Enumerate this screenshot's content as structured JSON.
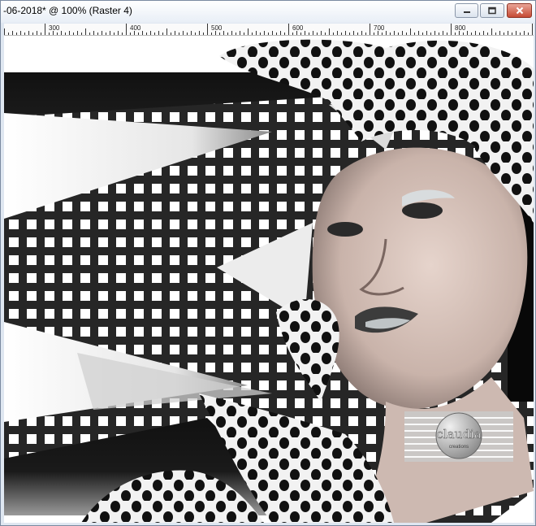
{
  "window": {
    "title": "-06-2018* @ 100% (Raster 4)"
  },
  "ruler": {
    "labels": [
      "300",
      "400",
      "500",
      "600",
      "700",
      "800"
    ]
  },
  "watermark": {
    "name": "claudia",
    "tagline": "creations"
  },
  "icons": {
    "minimize": "minimize-icon",
    "maximize": "maximize-icon",
    "close": "close-icon"
  },
  "colors": {
    "close_button": "#c64a35",
    "canvas_dark": "#222222",
    "window_frame": "#dfe7f1"
  }
}
